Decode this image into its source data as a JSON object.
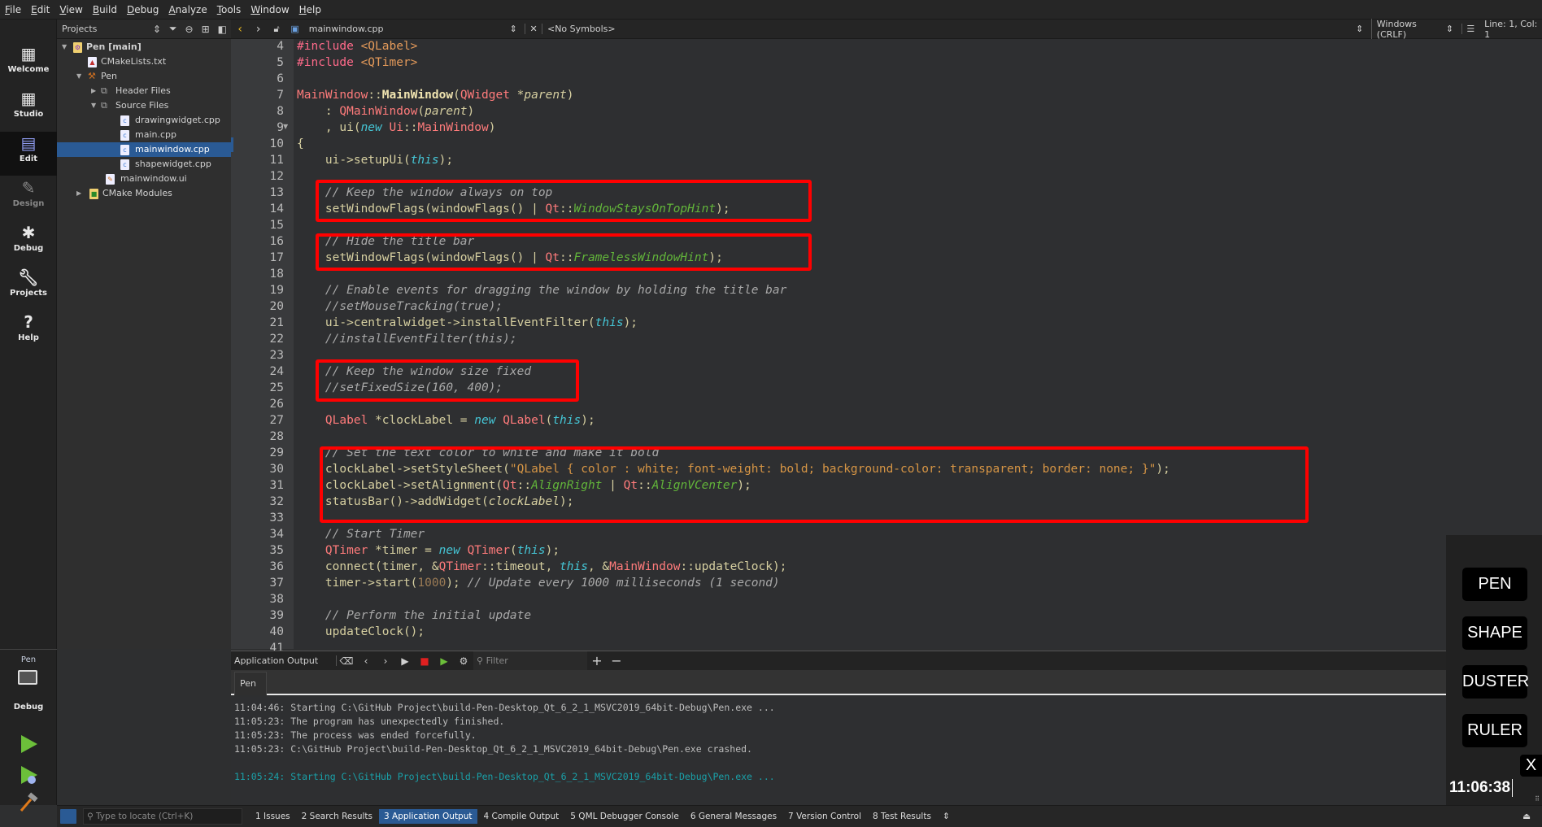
{
  "menu": [
    "File",
    "Edit",
    "View",
    "Build",
    "Debug",
    "Analyze",
    "Tools",
    "Window",
    "Help"
  ],
  "modes": [
    {
      "label": "Welcome",
      "icon": "grid-icon"
    },
    {
      "label": "Studio",
      "icon": "grid-icon"
    },
    {
      "label": "Edit",
      "icon": "document-icon",
      "active": true
    },
    {
      "label": "Design",
      "icon": "pencil-icon"
    },
    {
      "label": "Debug",
      "icon": "bug-icon"
    },
    {
      "label": "Projects",
      "icon": "wrench-icon"
    },
    {
      "label": "Help",
      "icon": "help-icon"
    }
  ],
  "kit": {
    "project": "Pen",
    "build": "Debug"
  },
  "projects": {
    "title": "Projects",
    "tree": [
      {
        "label": "Pen [main]",
        "depth": 0,
        "expanded": true,
        "bold": true
      },
      {
        "label": "CMakeLists.txt",
        "depth": 1
      },
      {
        "label": "Pen",
        "depth": 1,
        "expanded": true
      },
      {
        "label": "Header Files",
        "depth": 2,
        "expanded": false
      },
      {
        "label": "Source Files",
        "depth": 2,
        "expanded": true
      },
      {
        "label": "drawingwidget.cpp",
        "depth": 3
      },
      {
        "label": "main.cpp",
        "depth": 3
      },
      {
        "label": "mainwindow.cpp",
        "depth": 3,
        "selected": true
      },
      {
        "label": "shapewidget.cpp",
        "depth": 3
      },
      {
        "label": "mainwindow.ui",
        "depth": 2
      },
      {
        "label": "CMake Modules",
        "depth": 1,
        "expanded": false
      }
    ]
  },
  "editor": {
    "file": "mainwindow.cpp",
    "symbols": "<No Symbols>",
    "line_ending": "Windows (CRLF)",
    "position": "Line: 1, Col: 1",
    "first_line": 4,
    "lines": [
      "#include <QLabel>",
      "#include <QTimer>",
      "",
      "MainWindow::MainWindow(QWidget *parent)",
      "    : QMainWindow(parent)",
      "    , ui(new Ui::MainWindow)",
      "{",
      "    ui->setupUi(this);",
      "",
      "    // Keep the window always on top",
      "    setWindowFlags(windowFlags() | Qt::WindowStaysOnTopHint);",
      "",
      "    // Hide the title bar",
      "    setWindowFlags(windowFlags() | Qt::FramelessWindowHint);",
      "",
      "    // Enable events for dragging the window by holding the title bar",
      "    //setMouseTracking(true);",
      "    ui->centralwidget->installEventFilter(this);",
      "    //installEventFilter(this);",
      "",
      "    // Keep the window size fixed",
      "    //setFixedSize(160, 400);",
      "",
      "    QLabel *clockLabel = new QLabel(this);",
      "",
      "    // Set the text color to white and make it bold",
      "    clockLabel->setStyleSheet(\"QLabel { color : white; font-weight: bold; background-color: transparent; border: none; }\");",
      "    clockLabel->setAlignment(Qt::AlignRight | Qt::AlignVCenter);",
      "    statusBar()->addWidget(clockLabel);",
      "",
      "    // Start Timer",
      "    QTimer *timer = new QTimer(this);",
      "    connect(timer, &QTimer::timeout, this, &MainWindow::updateClock);",
      "    timer->start(1000); // Update every 1000 milliseconds (1 second)",
      "",
      "    // Perform the initial update",
      "    updateClock();",
      ""
    ]
  },
  "output": {
    "title": "Application Output",
    "filter_placeholder": "Filter",
    "tab": "Pen",
    "lines": [
      {
        "text": "11:04:46: Starting C:\\GitHub Project\\build-Pen-Desktop_Qt_6_2_1_MSVC2019_64bit-Debug\\Pen.exe ...",
        "style": "normal"
      },
      {
        "text": "11:05:23: The program has unexpectedly finished.",
        "style": "normal"
      },
      {
        "text": "11:05:23: The process was ended forcefully.",
        "style": "normal"
      },
      {
        "text": "11:05:23: C:\\GitHub Project\\build-Pen-Desktop_Qt_6_2_1_MSVC2019_64bit-Debug\\Pen.exe crashed.",
        "style": "normal"
      },
      {
        "text": "",
        "style": "normal"
      },
      {
        "text": "11:05:24: Starting C:\\GitHub Project\\build-Pen-Desktop_Qt_6_2_1_MSVC2019_64bit-Debug\\Pen.exe ...",
        "style": "cyan"
      }
    ]
  },
  "widget": {
    "buttons": [
      "PEN",
      "SHAPE",
      "DUSTER",
      "RULER"
    ],
    "close": "X",
    "clock": "11:06:38"
  },
  "statusbar": {
    "locator_placeholder": "Type to locate (Ctrl+K)",
    "panes": [
      {
        "label": "1  Issues"
      },
      {
        "label": "2  Search Results"
      },
      {
        "label": "3  Application Output",
        "active": true
      },
      {
        "label": "4  Compile Output"
      },
      {
        "label": "5  QML Debugger Console"
      },
      {
        "label": "6  General Messages"
      },
      {
        "label": "7  Version Control"
      },
      {
        "label": "8  Test Results"
      }
    ]
  },
  "colors": {
    "selection": "#2a5a94",
    "highlight_box": "#ff0000",
    "accent_run": "#6cbf3a"
  }
}
